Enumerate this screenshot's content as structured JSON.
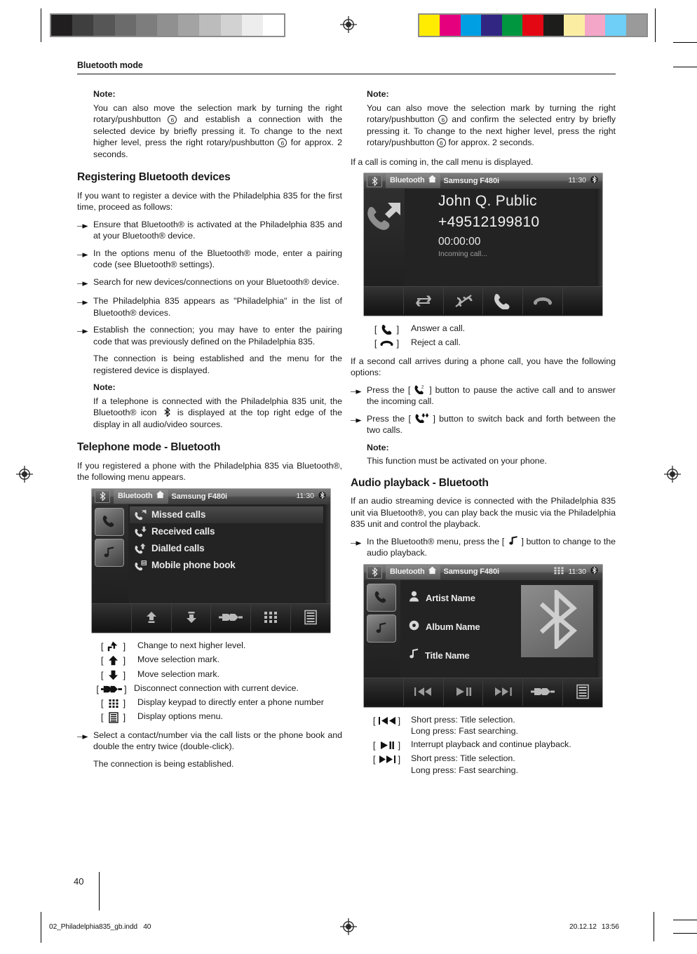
{
  "printer_marks": {
    "grayscale_swatches": [
      "#201e1e",
      "#3f3f3f",
      "#565656",
      "#6b6b6b",
      "#7d7d7d",
      "#909090",
      "#a3a3a3",
      "#bcbcbc",
      "#d2d2d2",
      "#ededed",
      "#ffffff"
    ],
    "color_swatches": [
      "#ffec00",
      "#e5007e",
      "#009fe3",
      "#312783",
      "#009640",
      "#e30613",
      "#1d1d1b",
      "#fbeea2",
      "#f4a6c8",
      "#6fcff6",
      "#9a9a9a"
    ]
  },
  "header": {
    "title": "Bluetooth mode"
  },
  "left_column": {
    "note1": {
      "label": "Note:",
      "text_a": "You can also move the selection mark by turning the right rotary/pushbutton ",
      "num1": "6",
      "text_b": " and establish a connection with the selected device by briefly pressing it. To change to the next higher level, press the right rotary/pushbutton ",
      "num2": "6",
      "text_c": " for approx. 2 seconds."
    },
    "heading_register": "Registering Bluetooth devices",
    "register_intro": "If you want to register a device with the Philadelphia 835 for the first time, proceed as follows:",
    "register_steps": [
      "Ensure that Bluetooth® is activated at the Philadelphia 835 and at your Bluetooth® device.",
      "In the options menu of the Bluetooth® mode, enter a pairing code (see Bluetooth® settings).",
      "Search for new devices/connections on your Bluetooth® device.",
      "The Philadelphia 835 appears as \"Philadelphia\" in the list of Bluetooth® devices.",
      "Establish the connection; you may have to enter the pairing code that was previously defined on the Philadelphia 835."
    ],
    "connection_established": "The connection is being established and the menu for the registered device is displayed.",
    "note2": {
      "label": "Note:",
      "text_a": "If a telephone is connected with the Philadelphia 835 unit, the Bluetooth® icon ",
      "icon": "bluetooth-glyph",
      "text_b": " is displayed at the top right edge of the display in all audio/video sources."
    },
    "heading_telephone": "Telephone mode - Bluetooth",
    "telephone_intro": "If you registered a phone with the Philadelphia 835 via Bluetooth®, the following menu appears.",
    "phone_screen": {
      "statusbar": {
        "bt_tile_icon": "bluetooth-tile-icon",
        "mode_label": "Bluetooth",
        "home_icon": "home-icon",
        "device": "Samsung F480i",
        "clock": "11:30",
        "bt_icon": "bluetooth-icon"
      },
      "rail": [
        "phone-icon",
        "music-note-icon"
      ],
      "menu_items": [
        {
          "label": "Missed calls",
          "icon": "missed-call-icon",
          "selected": true
        },
        {
          "label": "Received calls",
          "icon": "received-call-icon",
          "selected": false
        },
        {
          "label": "Dialled calls",
          "icon": "dialled-call-icon",
          "selected": false
        },
        {
          "label": "Mobile phone book",
          "icon": "phonebook-icon",
          "selected": false
        }
      ],
      "toolbar": [
        "",
        "up-level-icon",
        "down-icon",
        "disconnect-icon",
        "keypad-icon",
        "options-menu-icon"
      ]
    },
    "phone_keys": [
      {
        "glyph": "up-level-icon",
        "text": "Change to next higher level."
      },
      {
        "glyph": "arrow-up-icon",
        "text": "Move selection mark."
      },
      {
        "glyph": "arrow-down-icon",
        "text": "Move selection mark."
      },
      {
        "glyph": "disconnect-icon",
        "text": "Disconnect connection with current device."
      },
      {
        "glyph": "keypad-icon",
        "text": "Display keypad to directly enter a phone number"
      },
      {
        "glyph": "options-menu-icon",
        "text": "Display options menu."
      }
    ],
    "select_contact": "Select a contact/number via the call lists or the phone book and double the entry twice (double-click).",
    "connection_established2": "The connection is being established."
  },
  "right_column": {
    "note1": {
      "label": "Note:",
      "text_a": "You can also move the selection mark by turning the right rotary/pushbutton ",
      "num1": "6",
      "text_b": " and confirm the selected entry by briefly pressing it. To change to the next higher level, press the right rotary/pushbutton ",
      "num2": "6",
      "text_c": " for approx. 2 seconds."
    },
    "call_intro": "If a call is coming in, the call menu is displayed.",
    "call_screen": {
      "statusbar": {
        "bt_tile_icon": "bluetooth-tile-icon",
        "mode_label": "Bluetooth",
        "home_icon": "home-icon",
        "device": "Samsung F480i",
        "clock": "11:30",
        "bt_icon": "bluetooth-icon"
      },
      "big_icon": "incoming-call-icon",
      "caller_name": "John Q. Public",
      "caller_number": "+49512199810",
      "duration": "00:00:00",
      "status": "Incoming call...",
      "toolbar": [
        "",
        "swap-calls-icon",
        "merge-calls-icon",
        "answer-call-icon",
        "reject-call-icon",
        ""
      ]
    },
    "call_keys": [
      {
        "glyph": "answer-call-icon",
        "text": "Answer a call."
      },
      {
        "glyph": "reject-call-icon",
        "text": "Reject a call."
      }
    ],
    "second_call_intro": "If a second call arrives during a phone call, you have the following options:",
    "second_call_steps": [
      {
        "pre": "Press the [ ",
        "glyph": "call-waiting-icon",
        "post": " ] button to pause the active call and to answer the incoming call."
      },
      {
        "pre": "Press the [ ",
        "glyph": "swap-two-calls-icon",
        "post": " ] button to switch back and forth between the two calls."
      }
    ],
    "note2": {
      "label": "Note:",
      "text": "This function must be activated on your phone."
    },
    "heading_audio": "Audio playback - Bluetooth",
    "audio_intro": "If an audio streaming device is connected with the Philadelphia 835 unit via Bluetooth®, you can play back the music via the Philadelphia 835 unit and control the playback.",
    "audio_step": {
      "pre": "In the Bluetooth® menu, press the [ ",
      "glyph": "music-note-icon",
      "post": " ] button to change to the audio playback."
    },
    "audio_screen": {
      "statusbar": {
        "bt_tile_icon": "bluetooth-tile-icon",
        "mode_label": "Bluetooth",
        "home_icon": "home-icon",
        "device": "Samsung F480i",
        "keypad_icon": "keypad-icon",
        "clock": "11:30",
        "bt_icon": "bluetooth-icon"
      },
      "rail": [
        "phone-icon",
        "music-note-icon"
      ],
      "meta": [
        {
          "label": "Artist Name",
          "icon": "artist-icon"
        },
        {
          "label": "Album Name",
          "icon": "album-icon"
        },
        {
          "label": "Title Name",
          "icon": "title-icon"
        }
      ],
      "artwork_icon": "bluetooth-large-icon",
      "toolbar": [
        "",
        "previous-track-icon",
        "play-pause-icon",
        "next-track-icon",
        "disconnect-icon",
        "options-menu-icon"
      ]
    },
    "audio_keys": [
      {
        "glyph": "previous-track-icon",
        "line1": "Short press: Title selection.",
        "line2": "Long press: Fast searching."
      },
      {
        "glyph": "play-pause-icon",
        "line1": "Interrupt playback and continue playback.",
        "line2": ""
      },
      {
        "glyph": "next-track-icon",
        "line1": "Short press: Title selection.",
        "line2": "Long press: Fast searching."
      }
    ]
  },
  "footer": {
    "page_number": "40",
    "file_name": "02_Philadelphia835_gb.indd",
    "file_page": "40",
    "date": "20.12.12",
    "time": "13:56"
  }
}
